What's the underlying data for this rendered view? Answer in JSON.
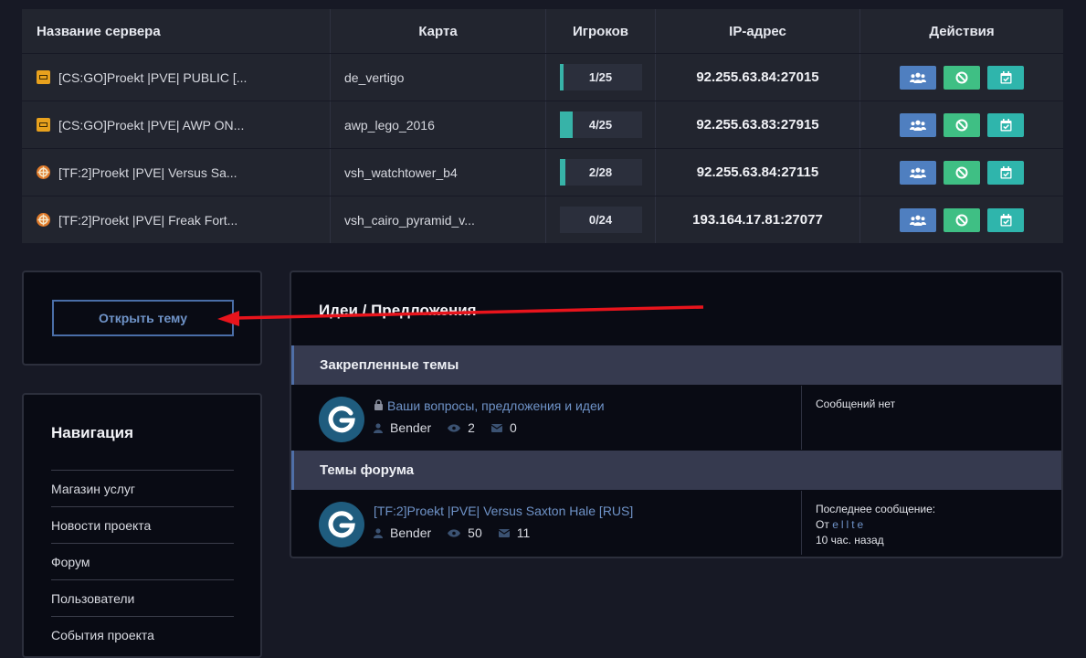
{
  "servers": {
    "headers": {
      "name": "Название сервера",
      "map": "Карта",
      "players": "Игроков",
      "ip": "IP-адрес",
      "actions": "Действия"
    },
    "rows": [
      {
        "game": "csgo",
        "name": "[CS:GO]Proekt |PVE| PUBLIC [...",
        "map": "de_vertigo",
        "players": "1/25",
        "fill": 0.04,
        "ip": "92.255.63.84:27015"
      },
      {
        "game": "csgo",
        "name": "[CS:GO]Proekt |PVE| AWP ON...",
        "map": "awp_lego_2016",
        "players": "4/25",
        "fill": 0.16,
        "ip": "92.255.63.83:27915"
      },
      {
        "game": "tf2",
        "name": "[TF:2]Proekt |PVE| Versus Sa...",
        "map": "vsh_watchtower_b4",
        "players": "2/28",
        "fill": 0.07,
        "ip": "92.255.63.84:27115"
      },
      {
        "game": "tf2",
        "name": "[TF:2]Proekt |PVE| Freak Fort...",
        "map": "vsh_cairo_pyramid_v...",
        "players": "0/24",
        "fill": 0,
        "ip": "193.164.17.81:27077"
      }
    ]
  },
  "open_topic": {
    "label": "Открыть тему"
  },
  "navigation": {
    "title": "Навигация",
    "items": [
      "Магазин услуг",
      "Новости проекта",
      "Форум",
      "Пользователи",
      "События проекта"
    ]
  },
  "forum": {
    "title": "Идеи / Предложения",
    "pinned_header": "Закрепленные темы",
    "topics_header": "Темы форума",
    "pinned_thread": {
      "title": "Ваши вопросы, предложения и идеи",
      "author": "Bender",
      "views": "2",
      "replies": "0",
      "last": "Сообщений нет"
    },
    "thread": {
      "title": "[TF:2]Proekt |PVE| Versus Saxton Hale [RUS]",
      "author": "Bender",
      "views": "50",
      "replies": "11",
      "last_label": "Последнее сообщение:",
      "last_from": "От",
      "last_user": "ellte",
      "last_time": "10 час. назад"
    }
  },
  "colors": {
    "accent": "#4f7fc0",
    "success": "#3fbf84",
    "teal": "#2fb5ac",
    "annotation_arrow": "#e8141c"
  }
}
